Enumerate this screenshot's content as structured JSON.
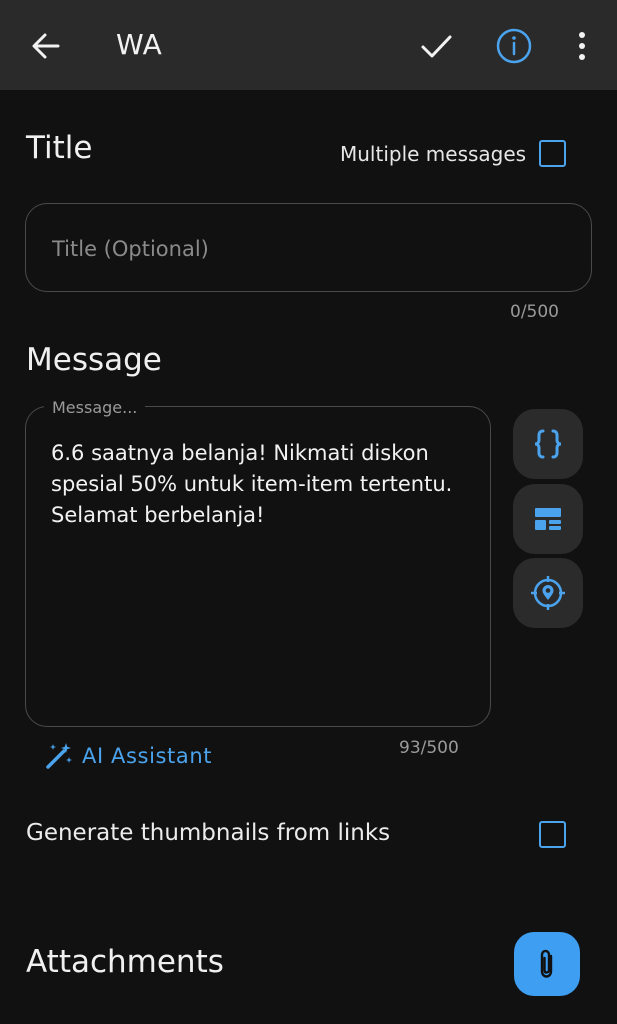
{
  "app_bar": {
    "title": "WA",
    "icons": {
      "back": "arrow-left-icon",
      "confirm": "check-icon",
      "info": "info-circle-icon",
      "more": "more-vertical-icon"
    },
    "accent_color": "#4aa3ec"
  },
  "title_section": {
    "heading": "Title",
    "multiple_messages_label": "Multiple messages",
    "multiple_messages_checked": false,
    "input_placeholder": "Title (Optional)",
    "input_value": "",
    "counter": "0/500"
  },
  "message_section": {
    "heading": "Message",
    "field_label": "Message...",
    "text": "6.6 saatnya belanja! Nikmati diskon spesial 50% untuk item-item tertentu. Selamat berbelanja!",
    "counter": "93/500",
    "side_buttons": [
      "curly-braces-icon",
      "template-icon",
      "location-icon"
    ],
    "ai_assistant_label": "AI Assistant"
  },
  "thumbnails": {
    "label": "Generate thumbnails from links",
    "checked": false
  },
  "attachments": {
    "heading": "Attachments",
    "button_icon": "paperclip-icon",
    "button_color": "#3d9ef2"
  }
}
